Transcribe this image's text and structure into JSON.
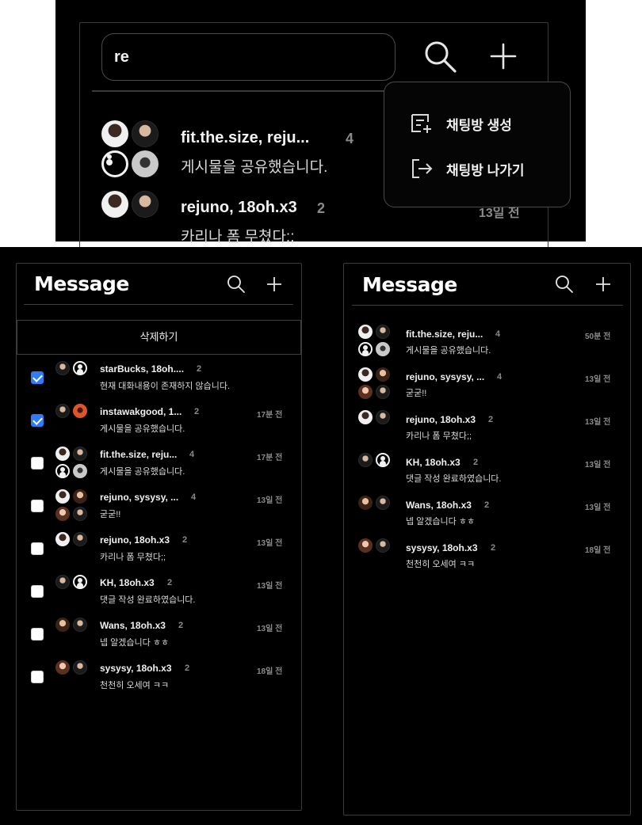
{
  "zoom_panel": {
    "search_value": "re",
    "menu": {
      "create_label": "채팅방 생성",
      "leave_label": "채팅방 나가기"
    },
    "rows": [
      {
        "name": "fit.the.size, reju...",
        "count": "4",
        "message": "게시물을 공유했습니다.",
        "time": ""
      },
      {
        "name": "rejuno, 18oh.x3",
        "count": "2",
        "message": "카리나 폼 무쳤다;;",
        "time": "13일 전"
      }
    ]
  },
  "edit_panel": {
    "title": "Message",
    "delete_label": "삭제하기",
    "rows": [
      {
        "checked": true,
        "name": "starBucks, 18oh....",
        "count": "2",
        "message": "현재 대화내용이 존재하지 않습니다.",
        "time": ""
      },
      {
        "checked": true,
        "name": "instawakgood, 1...",
        "count": "2",
        "message": "게시물을 공유했습니다.",
        "time": "17분 전"
      },
      {
        "checked": false,
        "name": "fit.the.size, reju...",
        "count": "4",
        "message": "게시물을 공유했습니다.",
        "time": "17분 전"
      },
      {
        "checked": false,
        "name": "rejuno, sysysy, ...",
        "count": "4",
        "message": "굳굳!!",
        "time": "13일 전"
      },
      {
        "checked": false,
        "name": "rejuno, 18oh.x3",
        "count": "2",
        "message": "카리나 폼 무쳤다;;",
        "time": "13일 전"
      },
      {
        "checked": false,
        "name": "KH, 18oh.x3",
        "count": "2",
        "message": "댓글 작성 완료하였습니다.",
        "time": "13일 전"
      },
      {
        "checked": false,
        "name": "Wans, 18oh.x3",
        "count": "2",
        "message": "넵 알겠습니다 ㅎㅎ",
        "time": "13일 전"
      },
      {
        "checked": false,
        "name": "sysysy, 18oh.x3",
        "count": "2",
        "message": "천천히 오세여 ㅋㅋ",
        "time": "18일 전"
      }
    ]
  },
  "list_panel": {
    "title": "Message",
    "rows": [
      {
        "name": "fit.the.size, reju...",
        "count": "4",
        "message": "게시물을 공유했습니다.",
        "time": "50분 전"
      },
      {
        "name": "rejuno, sysysy, ...",
        "count": "4",
        "message": "굳굳!!",
        "time": "13일 전"
      },
      {
        "name": "rejuno, 18oh.x3",
        "count": "2",
        "message": "카리나 폼 무쳤다;;",
        "time": "13일 전"
      },
      {
        "name": "KH, 18oh.x3",
        "count": "2",
        "message": "댓글 작성 완료하였습니다.",
        "time": "13일 전"
      },
      {
        "name": "Wans, 18oh.x3",
        "count": "2",
        "message": "넵 알겠습니다 ㅎㅎ",
        "time": "13일 전"
      },
      {
        "name": "sysysy, 18oh.x3",
        "count": "2",
        "message": "천천히 오세여 ㅋㅋ",
        "time": "18일 전"
      }
    ]
  }
}
